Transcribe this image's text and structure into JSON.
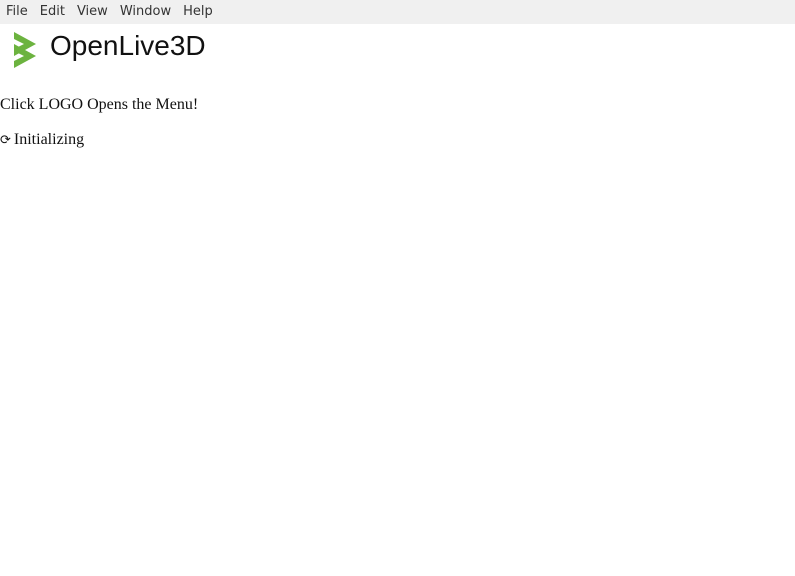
{
  "menubar": {
    "items": [
      {
        "label": "File"
      },
      {
        "label": "Edit"
      },
      {
        "label": "View"
      },
      {
        "label": "Window"
      },
      {
        "label": "Help"
      }
    ]
  },
  "header": {
    "logo_icon": "openlive3d-logo-icon",
    "logo_color": "#6cb33f",
    "title": "OpenLive3D"
  },
  "main": {
    "hint": "Click LOGO Opens the Menu!",
    "status": {
      "icon": "⟳",
      "text": "Initializing"
    }
  }
}
